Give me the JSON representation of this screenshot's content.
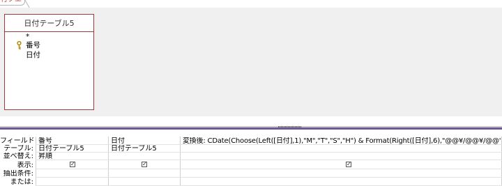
{
  "document_tab": {
    "label": "付クエリ5"
  },
  "design_table": {
    "title": "日付テーブル5",
    "fields": [
      "*",
      "番号",
      "日付"
    ],
    "primary_key_field": "番号",
    "icons": {
      "primary_key": "key-icon"
    },
    "colors": {
      "border": "#a03a3a"
    }
  },
  "query_grid": {
    "row_labels": [
      "フィールド:",
      "テーブル:",
      "並べ替え:",
      "表示:",
      "抽出条件:",
      "または:"
    ],
    "columns": [
      {
        "field": "番号",
        "table": "日付テーブル5",
        "sort": "昇順",
        "show": true,
        "criteria": "",
        "or": ""
      },
      {
        "field": "日付",
        "table": "日付テーブル5",
        "sort": "",
        "show": true,
        "criteria": "",
        "or": ""
      },
      {
        "field": "変換後: CDate(Choose(Left([日付],1),\"M\",\"T\",\"S\",\"H\") & Format(Right([日付],6),\"@@¥/@@¥/@@\"))",
        "table": "",
        "sort": "",
        "show": true,
        "criteria": "",
        "or": ""
      }
    ],
    "colors": {
      "top_border": "#6b5a97"
    }
  }
}
